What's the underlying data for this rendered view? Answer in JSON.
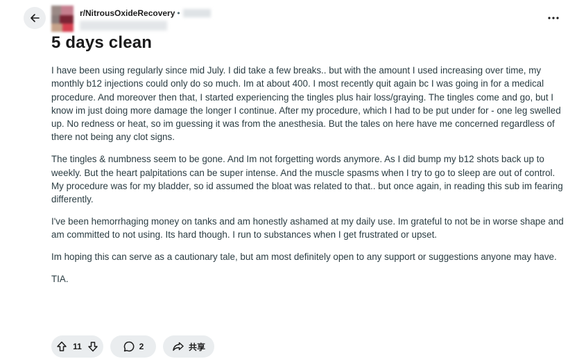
{
  "header": {
    "subreddit": "r/NitrousOxideRecovery",
    "separator": "•"
  },
  "post": {
    "title": "5 days clean",
    "paragraphs": [
      "I have been using regularly since mid July. I did take a few breaks.. but with the amount I used increasing over time, my monthly b12 injections could only do so much. Im at about 400. I most recently quit again bc I was going in for a medical procedure. And moreover then that, I started experiencing the tingles plus hair loss/graying. The tingles come and go, but I know im just doing more damage the longer I continue. After my procedure, which I had to be put under for - one leg swelled up. No redness or heat, so im guessing it was from the anesthesia. But the tales on here have me concerned regardless of there not being any clot signs.",
      "The tingles & numbness seem to be gone. And Im not forgetting words anymore. As I did bump my b12 shots back up to weekly. But the heart palpitations can be super intense. And the muscle spasms when I try to go to sleep are out of control. My procedure was for my bladder, so id assumed the bloat was related to that.. but once again, in reading this sub im fearing differently.",
      "I've been hemorrhaging money on tanks and am honestly ashamed at my daily use. Im grateful to not be in worse shape and am committed to not using. Its hard though. I run to substances when I get frustrated or upset.",
      "Im hoping this can serve as a cautionary tale, but am most definitely open to any support or suggestions anyone may have.",
      "TIA."
    ]
  },
  "actions": {
    "votes": "11",
    "comments": "2",
    "share_label": "共享"
  },
  "icons": {
    "back": "arrow-left-icon",
    "more": "more-horizontal-icon",
    "upvote": "upvote-arrow-icon",
    "downvote": "downvote-arrow-icon",
    "comment": "comment-bubble-icon",
    "share": "share-arrow-icon"
  },
  "colors": {
    "pill_background": "#eaedef",
    "back_button_background": "#eceef0",
    "body_text": "#2a3c42",
    "title_text": "#1a1a1b"
  }
}
